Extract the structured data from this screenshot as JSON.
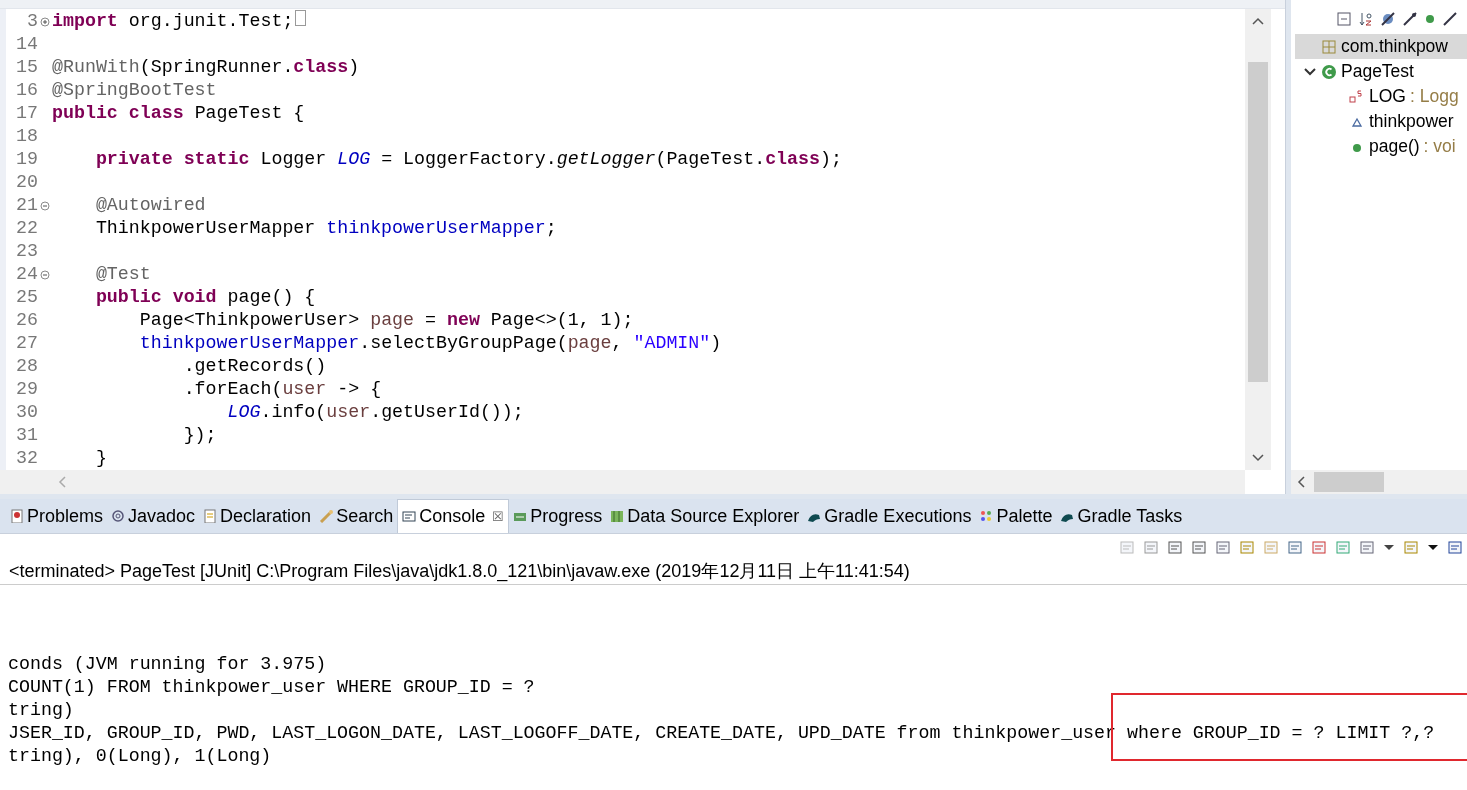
{
  "editor": {
    "lines": [
      {
        "number": "3",
        "folded": true,
        "tokens": [
          {
            "kind": "keyword",
            "text": "import"
          },
          {
            "kind": "plain",
            "text": " org.junit.Test;"
          }
        ]
      },
      {
        "number": "14"
      },
      {
        "number": "15",
        "tokens": [
          {
            "kind": "annotation",
            "text": "@RunWith"
          },
          {
            "kind": "plain",
            "text": "(SpringRunner."
          },
          {
            "kind": "keyword",
            "text": "class"
          },
          {
            "kind": "plain",
            "text": ")"
          }
        ]
      },
      {
        "number": "16",
        "tokens": [
          {
            "kind": "annotation",
            "text": "@SpringBootTest"
          }
        ]
      },
      {
        "number": "17",
        "tokens": [
          {
            "kind": "keyword",
            "text": "public class"
          },
          {
            "kind": "plain",
            "text": " PageTest {"
          }
        ]
      },
      {
        "number": "18"
      },
      {
        "number": "19",
        "tokens": [
          {
            "kind": "keyword",
            "text": "    private static"
          },
          {
            "kind": "plain",
            "text": " Logger "
          },
          {
            "kind": "static",
            "text": "LOG"
          },
          {
            "kind": "plain",
            "text": " = LoggerFactory."
          },
          {
            "kind": "static-method",
            "text": "getLogger"
          },
          {
            "kind": "plain",
            "text": "(PageTest."
          },
          {
            "kind": "keyword",
            "text": "class"
          },
          {
            "kind": "plain",
            "text": ");"
          }
        ]
      },
      {
        "number": "20"
      },
      {
        "number": "21",
        "folded": false,
        "tokens": [
          {
            "kind": "annotation",
            "text": "    @Autowired"
          }
        ]
      },
      {
        "number": "22",
        "tokens": [
          {
            "kind": "plain",
            "text": "    ThinkpowerUserMapper "
          },
          {
            "kind": "field",
            "text": "thinkpowerUserMapper"
          },
          {
            "kind": "plain",
            "text": ";"
          }
        ]
      },
      {
        "number": "23"
      },
      {
        "number": "24",
        "folded": false,
        "tokens": [
          {
            "kind": "annotation",
            "text": "    @Test"
          }
        ]
      },
      {
        "number": "25",
        "tokens": [
          {
            "kind": "keyword",
            "text": "    public void"
          },
          {
            "kind": "plain",
            "text": " page() {"
          }
        ]
      },
      {
        "number": "26",
        "tokens": [
          {
            "kind": "plain",
            "text": "        Page<ThinkpowerUser> "
          },
          {
            "kind": "local",
            "text": "page"
          },
          {
            "kind": "plain",
            "text": " = "
          },
          {
            "kind": "keyword",
            "text": "new"
          },
          {
            "kind": "plain",
            "text": " Page<>(1, 1);"
          }
        ]
      },
      {
        "number": "27",
        "tokens": [
          {
            "kind": "field",
            "text": "        thinkpowerUserMapper"
          },
          {
            "kind": "plain",
            "text": ".selectByGroupPage("
          },
          {
            "kind": "local",
            "text": "page"
          },
          {
            "kind": "plain",
            "text": ", "
          },
          {
            "kind": "string",
            "text": "\"ADMIN\""
          },
          {
            "kind": "plain",
            "text": ")"
          }
        ]
      },
      {
        "number": "28",
        "tokens": [
          {
            "kind": "plain",
            "text": "            .getRecords()"
          }
        ]
      },
      {
        "number": "29",
        "tokens": [
          {
            "kind": "plain",
            "text": "            .forEach("
          },
          {
            "kind": "local",
            "text": "user"
          },
          {
            "kind": "plain",
            "text": " -> {"
          }
        ]
      },
      {
        "number": "30",
        "tokens": [
          {
            "kind": "static",
            "text": "                LOG"
          },
          {
            "kind": "plain",
            "text": ".info("
          },
          {
            "kind": "local",
            "text": "user"
          },
          {
            "kind": "plain",
            "text": ".getUserId());"
          }
        ]
      },
      {
        "number": "31",
        "tokens": [
          {
            "kind": "plain",
            "text": "            });"
          }
        ]
      },
      {
        "number": "32",
        "tokens": [
          {
            "kind": "plain",
            "text": "    }"
          }
        ]
      }
    ]
  },
  "outline": {
    "items": [
      {
        "kind": "import",
        "label": "com.thinkpow",
        "selected": true
      },
      {
        "kind": "class",
        "label": "PageTest",
        "selected": false,
        "expanded": true,
        "children": [
          {
            "kind": "static-field",
            "label": "LOG",
            "detail": " : Logg",
            "selected": false
          },
          {
            "kind": "field",
            "label": "thinkpower",
            "selected": false
          },
          {
            "kind": "method",
            "label": "page()",
            "detail": " : voi",
            "selected": false
          }
        ]
      }
    ]
  },
  "console": {
    "tabs": [
      {
        "label": "Problems",
        "selected": false
      },
      {
        "label": "Javadoc",
        "selected": false
      },
      {
        "label": "Declaration",
        "selected": false
      },
      {
        "label": "Search",
        "selected": false
      },
      {
        "label": "Console",
        "selected": true,
        "close": "☒"
      },
      {
        "label": "Progress",
        "selected": false
      },
      {
        "label": "Data Source Explorer",
        "selected": false
      },
      {
        "label": "Gradle Executions",
        "selected": false
      },
      {
        "label": "Palette",
        "selected": false
      },
      {
        "label": "Gradle Tasks",
        "selected": false
      }
    ],
    "status": "<terminated> PageTest [JUnit] C:\\Program Files\\java\\jdk1.8.0_121\\bin\\javaw.exe (2019年12月11日 上午11:41:54)",
    "output": [
      "conds (JVM running for 3.975)",
      "COUNT(1) FROM thinkpower_user WHERE GROUP_ID = ?",
      "tring)",
      "JSER_ID, GROUP_ID, PWD, LAST_LOGON_DATE, LAST_LOGOFF_DATE, CREATE_DATE, UPD_DATE from thinkpower_user where GROUP_ID = ? LIMIT ?,?",
      "tring), 0(Long), 1(Long)"
    ]
  }
}
